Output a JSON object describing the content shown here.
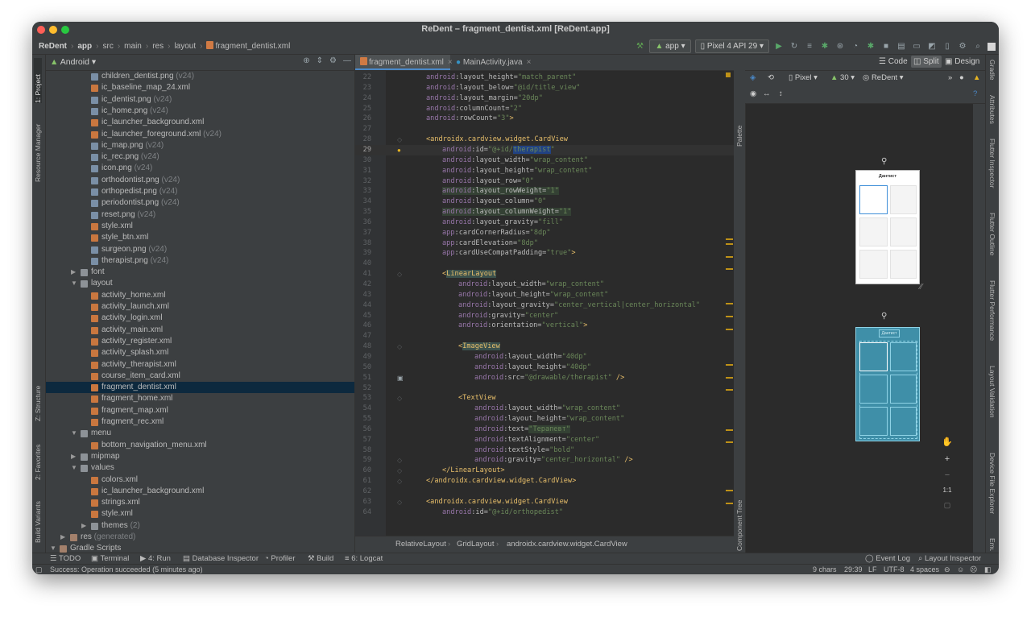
{
  "window": {
    "title": "ReDent – fragment_dentist.xml [ReDent.app]"
  },
  "breadcrumb": [
    {
      "label": "ReDent"
    },
    {
      "label": "app"
    },
    {
      "label": "src"
    },
    {
      "label": "main"
    },
    {
      "label": "res"
    },
    {
      "label": "layout"
    },
    {
      "label": "fragment_dentist.xml"
    }
  ],
  "toolbar": {
    "module": "app",
    "device": "Pixel 4 API 29"
  },
  "left_tabs": {
    "project": "1: Project",
    "resource_manager": "Resource Manager",
    "structure": "Z: Structure",
    "favorites": "2: Favorites",
    "build_variants": "Build Variants"
  },
  "right_tabs": {
    "gradle": "Gradle",
    "attributes": "Attributes",
    "flutter_inspector": "Flutter Inspector",
    "flutter_outline": "Flutter Outline",
    "flutter_performance": "Flutter Performance",
    "layout_validation": "Layout Validation",
    "device_file_explorer": "Device File Explorer",
    "emulator": "Emulator"
  },
  "project": {
    "view": "Android",
    "rows": [
      {
        "name": "children_dentist.png",
        "hint": "(v24)",
        "kind": "png",
        "depth": 4
      },
      {
        "name": "ic_baseline_map_24.xml",
        "hint": "",
        "kind": "xml",
        "depth": 4
      },
      {
        "name": "ic_dentist.png",
        "hint": "(v24)",
        "kind": "png",
        "depth": 4
      },
      {
        "name": "ic_home.png",
        "hint": "(v24)",
        "kind": "png",
        "depth": 4
      },
      {
        "name": "ic_launcher_background.xml",
        "hint": "",
        "kind": "xml",
        "depth": 4
      },
      {
        "name": "ic_launcher_foreground.xml",
        "hint": "(v24)",
        "kind": "xml",
        "depth": 4
      },
      {
        "name": "ic_map.png",
        "hint": "(v24)",
        "kind": "png",
        "depth": 4
      },
      {
        "name": "ic_rec.png",
        "hint": "(v24)",
        "kind": "png",
        "depth": 4
      },
      {
        "name": "icon.png",
        "hint": "(v24)",
        "kind": "png",
        "depth": 4
      },
      {
        "name": "orthodontist.png",
        "hint": "(v24)",
        "kind": "png",
        "depth": 4
      },
      {
        "name": "orthopedist.png",
        "hint": "(v24)",
        "kind": "png",
        "depth": 4
      },
      {
        "name": "periodontist.png",
        "hint": "(v24)",
        "kind": "png",
        "depth": 4
      },
      {
        "name": "reset.png",
        "hint": "(v24)",
        "kind": "png",
        "depth": 4
      },
      {
        "name": "style.xml",
        "hint": "",
        "kind": "xml",
        "depth": 4
      },
      {
        "name": "style_btn.xml",
        "hint": "",
        "kind": "xml",
        "depth": 4
      },
      {
        "name": "surgeon.png",
        "hint": "(v24)",
        "kind": "png",
        "depth": 4
      },
      {
        "name": "therapist.png",
        "hint": "(v24)",
        "kind": "png",
        "depth": 4
      },
      {
        "name": "font",
        "hint": "",
        "kind": "folder",
        "depth": 3,
        "arrow": "collapsed"
      },
      {
        "name": "layout",
        "hint": "",
        "kind": "folder",
        "depth": 3,
        "arrow": "expanded"
      },
      {
        "name": "activity_home.xml",
        "hint": "",
        "kind": "xml",
        "depth": 4
      },
      {
        "name": "activity_launch.xml",
        "hint": "",
        "kind": "xml",
        "depth": 4
      },
      {
        "name": "activity_login.xml",
        "hint": "",
        "kind": "xml",
        "depth": 4
      },
      {
        "name": "activity_main.xml",
        "hint": "",
        "kind": "xml",
        "depth": 4
      },
      {
        "name": "activity_register.xml",
        "hint": "",
        "kind": "xml",
        "depth": 4
      },
      {
        "name": "activity_splash.xml",
        "hint": "",
        "kind": "xml",
        "depth": 4
      },
      {
        "name": "activity_therapist.xml",
        "hint": "",
        "kind": "xml",
        "depth": 4
      },
      {
        "name": "course_item_card.xml",
        "hint": "",
        "kind": "xml",
        "depth": 4
      },
      {
        "name": "fragment_dentist.xml",
        "hint": "",
        "kind": "xml",
        "depth": 4,
        "selected": true
      },
      {
        "name": "fragment_home.xml",
        "hint": "",
        "kind": "xml",
        "depth": 4
      },
      {
        "name": "fragment_map.xml",
        "hint": "",
        "kind": "xml",
        "depth": 4
      },
      {
        "name": "fragment_rec.xml",
        "hint": "",
        "kind": "xml",
        "depth": 4
      },
      {
        "name": "menu",
        "hint": "",
        "kind": "folder",
        "depth": 3,
        "arrow": "expanded"
      },
      {
        "name": "bottom_navigation_menu.xml",
        "hint": "",
        "kind": "xml",
        "depth": 4
      },
      {
        "name": "mipmap",
        "hint": "",
        "kind": "folder",
        "depth": 3,
        "arrow": "collapsed"
      },
      {
        "name": "values",
        "hint": "",
        "kind": "folder",
        "depth": 3,
        "arrow": "expanded"
      },
      {
        "name": "colors.xml",
        "hint": "",
        "kind": "xml",
        "depth": 4
      },
      {
        "name": "ic_launcher_background.xml",
        "hint": "",
        "kind": "xml",
        "depth": 4
      },
      {
        "name": "strings.xml",
        "hint": "",
        "kind": "xml",
        "depth": 4
      },
      {
        "name": "style.xml",
        "hint": "",
        "kind": "xml",
        "depth": 4
      },
      {
        "name": "themes",
        "hint": "(2)",
        "kind": "folder",
        "depth": 4,
        "arrow": "collapsed"
      },
      {
        "name": "res",
        "hint": "(generated)",
        "kind": "resfolder",
        "depth": 2,
        "arrow": "collapsed"
      },
      {
        "name": "Gradle Scripts",
        "hint": "",
        "kind": "resfolder",
        "depth": 1,
        "arrow": "expanded"
      }
    ]
  },
  "editor": {
    "tabs": [
      {
        "label": "fragment_dentist.xml",
        "active": true
      },
      {
        "label": "MainActivity.java",
        "active": false
      }
    ],
    "current_line": 29,
    "lines": [
      {
        "n": 22,
        "indent": 2,
        "parts": [
          [
            "ns",
            "android"
          ],
          [
            "at",
            ":layout_height="
          ],
          [
            "val",
            "\"match_parent\""
          ]
        ]
      },
      {
        "n": 23,
        "indent": 2,
        "parts": [
          [
            "ns",
            "android"
          ],
          [
            "at",
            ":layout_below="
          ],
          [
            "val",
            "\"@id/title_view\""
          ]
        ]
      },
      {
        "n": 24,
        "indent": 2,
        "parts": [
          [
            "ns",
            "android"
          ],
          [
            "at",
            ":layout_margin="
          ],
          [
            "val",
            "\"20dp\""
          ]
        ]
      },
      {
        "n": 25,
        "indent": 2,
        "parts": [
          [
            "ns",
            "android"
          ],
          [
            "at",
            ":columnCount="
          ],
          [
            "val",
            "\"2\""
          ]
        ]
      },
      {
        "n": 26,
        "indent": 2,
        "parts": [
          [
            "ns",
            "android"
          ],
          [
            "at",
            ":rowCount="
          ],
          [
            "val",
            "\"3\""
          ],
          [
            "tg",
            ">"
          ]
        ]
      },
      {
        "n": 27,
        "indent": 0,
        "parts": []
      },
      {
        "n": 28,
        "indent": 2,
        "parts": [
          [
            "tg",
            "<androidx.cardview.widget.CardView"
          ]
        ]
      },
      {
        "n": 29,
        "indent": 3,
        "parts": [
          [
            "ns",
            "android"
          ],
          [
            "at",
            ":id="
          ],
          [
            "val",
            "\"@+id/"
          ],
          [
            "valsel",
            "therapist"
          ],
          [
            "val",
            "\""
          ]
        ]
      },
      {
        "n": 30,
        "indent": 3,
        "parts": [
          [
            "ns",
            "android"
          ],
          [
            "at",
            ":layout_width="
          ],
          [
            "val",
            "\"wrap_content\""
          ]
        ]
      },
      {
        "n": 31,
        "indent": 3,
        "parts": [
          [
            "ns",
            "android"
          ],
          [
            "at",
            ":layout_height="
          ],
          [
            "val",
            "\"wrap_content\""
          ]
        ]
      },
      {
        "n": 32,
        "indent": 3,
        "parts": [
          [
            "ns",
            "android"
          ],
          [
            "at",
            ":layout_row="
          ],
          [
            "val",
            "\"0\""
          ]
        ]
      },
      {
        "n": 33,
        "indent": 3,
        "parts": [
          [
            "nsh",
            "android"
          ],
          [
            "ath",
            ":layout_rowWeight="
          ],
          [
            "valh",
            "\"1\""
          ]
        ]
      },
      {
        "n": 34,
        "indent": 3,
        "parts": [
          [
            "ns",
            "android"
          ],
          [
            "at",
            ":layout_column="
          ],
          [
            "val",
            "\"0\""
          ]
        ]
      },
      {
        "n": 35,
        "indent": 3,
        "parts": [
          [
            "nsh",
            "android"
          ],
          [
            "ath",
            ":layout_columnWeight="
          ],
          [
            "valh",
            "\"1\""
          ]
        ]
      },
      {
        "n": 36,
        "indent": 3,
        "parts": [
          [
            "ns",
            "android"
          ],
          [
            "at",
            ":layout_gravity="
          ],
          [
            "val",
            "\"fill\""
          ]
        ]
      },
      {
        "n": 37,
        "indent": 3,
        "parts": [
          [
            "ns",
            "app"
          ],
          [
            "at",
            ":cardCornerRadius="
          ],
          [
            "val",
            "\"8dp\""
          ]
        ]
      },
      {
        "n": 38,
        "indent": 3,
        "parts": [
          [
            "ns",
            "app"
          ],
          [
            "at",
            ":cardElevation="
          ],
          [
            "val",
            "\"8dp\""
          ]
        ]
      },
      {
        "n": 39,
        "indent": 3,
        "parts": [
          [
            "ns",
            "app"
          ],
          [
            "at",
            ":cardUseCompatPadding="
          ],
          [
            "val",
            "\"true\""
          ],
          [
            "tg",
            ">"
          ]
        ]
      },
      {
        "n": 40,
        "indent": 0,
        "parts": []
      },
      {
        "n": 41,
        "indent": 3,
        "parts": [
          [
            "tg",
            "<"
          ],
          [
            "tgh",
            "LinearLayout"
          ]
        ]
      },
      {
        "n": 42,
        "indent": 4,
        "parts": [
          [
            "ns",
            "android"
          ],
          [
            "at",
            ":layout_width="
          ],
          [
            "val",
            "\"wrap_content\""
          ]
        ]
      },
      {
        "n": 43,
        "indent": 4,
        "parts": [
          [
            "ns",
            "android"
          ],
          [
            "at",
            ":layout_height="
          ],
          [
            "val",
            "\"wrap_content\""
          ]
        ]
      },
      {
        "n": 44,
        "indent": 4,
        "parts": [
          [
            "ns",
            "android"
          ],
          [
            "at",
            ":layout_gravity="
          ],
          [
            "val",
            "\"center_vertical|center_horizontal\""
          ]
        ]
      },
      {
        "n": 45,
        "indent": 4,
        "parts": [
          [
            "ns",
            "android"
          ],
          [
            "at",
            ":gravity="
          ],
          [
            "val",
            "\"center\""
          ]
        ]
      },
      {
        "n": 46,
        "indent": 4,
        "parts": [
          [
            "ns",
            "android"
          ],
          [
            "at",
            ":orientation="
          ],
          [
            "val",
            "\"vertical\""
          ],
          [
            "tg",
            ">"
          ]
        ]
      },
      {
        "n": 47,
        "indent": 0,
        "parts": []
      },
      {
        "n": 48,
        "indent": 4,
        "parts": [
          [
            "tg",
            "<"
          ],
          [
            "tgh",
            "ImageView"
          ]
        ]
      },
      {
        "n": 49,
        "indent": 5,
        "parts": [
          [
            "ns",
            "android"
          ],
          [
            "at",
            ":layout_width="
          ],
          [
            "val",
            "\"40dp\""
          ]
        ]
      },
      {
        "n": 50,
        "indent": 5,
        "parts": [
          [
            "ns",
            "android"
          ],
          [
            "at",
            ":layout_height="
          ],
          [
            "val",
            "\"40dp\""
          ]
        ]
      },
      {
        "n": 51,
        "indent": 5,
        "parts": [
          [
            "ns",
            "android"
          ],
          [
            "at",
            ":src="
          ],
          [
            "val",
            "\"@drawable/therapist\""
          ],
          [
            "tg",
            " />"
          ]
        ]
      },
      {
        "n": 52,
        "indent": 0,
        "parts": []
      },
      {
        "n": 53,
        "indent": 4,
        "parts": [
          [
            "tg",
            "<TextView"
          ]
        ]
      },
      {
        "n": 54,
        "indent": 5,
        "parts": [
          [
            "ns",
            "android"
          ],
          [
            "at",
            ":layout_width="
          ],
          [
            "val",
            "\"wrap_content\""
          ]
        ]
      },
      {
        "n": 55,
        "indent": 5,
        "parts": [
          [
            "ns",
            "android"
          ],
          [
            "at",
            ":layout_height="
          ],
          [
            "val",
            "\"wrap_content\""
          ]
        ]
      },
      {
        "n": 56,
        "indent": 5,
        "parts": [
          [
            "ns",
            "android"
          ],
          [
            "at",
            ":text="
          ],
          [
            "valh",
            "\"Терапевт\""
          ]
        ]
      },
      {
        "n": 57,
        "indent": 5,
        "parts": [
          [
            "ns",
            "android"
          ],
          [
            "at",
            ":textAlignment="
          ],
          [
            "val",
            "\"center\""
          ]
        ]
      },
      {
        "n": 58,
        "indent": 5,
        "parts": [
          [
            "ns",
            "android"
          ],
          [
            "at",
            ":textStyle="
          ],
          [
            "val",
            "\"bold\""
          ]
        ]
      },
      {
        "n": 59,
        "indent": 5,
        "parts": [
          [
            "ns",
            "android"
          ],
          [
            "at",
            ":gravity="
          ],
          [
            "val",
            "\"center_horizontal\""
          ],
          [
            "tg",
            " />"
          ]
        ]
      },
      {
        "n": 60,
        "indent": 3,
        "parts": [
          [
            "tg",
            "</LinearLayout>"
          ]
        ]
      },
      {
        "n": 61,
        "indent": 2,
        "parts": [
          [
            "tg",
            "</androidx.cardview.widget.CardView>"
          ]
        ]
      },
      {
        "n": 62,
        "indent": 0,
        "parts": []
      },
      {
        "n": 63,
        "indent": 2,
        "parts": [
          [
            "tg",
            "<androidx.cardview.widget.CardView"
          ]
        ]
      },
      {
        "n": 64,
        "indent": 3,
        "parts": [
          [
            "ns",
            "android"
          ],
          [
            "at",
            ":id="
          ],
          [
            "val",
            "\"@+id/orthopedist\""
          ]
        ]
      }
    ],
    "breadcrumb": [
      "RelativeLayout",
      "GridLayout",
      "androidx.cardview.widget.CardView"
    ]
  },
  "design": {
    "modes": {
      "code": "Code",
      "split": "Split",
      "design": "Design"
    },
    "toolbar": {
      "device": "Pixel",
      "api": "30",
      "theme": "ReDent"
    },
    "palette_label": "Palette",
    "component_tree_label": "Component Tree",
    "preview_title": "Дантист",
    "blueprint_label": "Дантист",
    "zoom_label": "1:1"
  },
  "bottom_tools": {
    "todo": "TODO",
    "terminal": "Terminal",
    "run": "4: Run",
    "database": "Database Inspector",
    "profiler": "Profiler",
    "build": "Build",
    "logcat": "6: Logcat",
    "event_log": "Event Log",
    "layout_inspector": "Layout Inspector"
  },
  "status": {
    "message": "Success: Operation succeeded (5 minutes ago)",
    "chars": "9 chars",
    "position": "29:39",
    "line_sep": "LF",
    "encoding": "UTF-8",
    "indent": "4 spaces"
  },
  "colors": {
    "accent": "#4a88c7",
    "tag": "#e8bf6a",
    "value": "#6a8759",
    "namespace": "#9876aa",
    "selection": "#0d293e"
  }
}
